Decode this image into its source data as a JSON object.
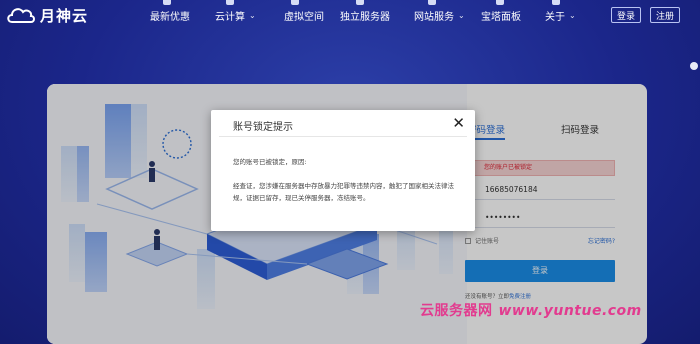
{
  "brand": {
    "name": "月神云"
  },
  "nav": {
    "items": [
      {
        "label": "最新优惠",
        "has_dropdown": false
      },
      {
        "label": "云计算",
        "has_dropdown": true
      },
      {
        "label": "虚拟空间",
        "has_dropdown": false
      },
      {
        "label": "独立服务器",
        "has_dropdown": false
      },
      {
        "label": "网站服务",
        "has_dropdown": true
      },
      {
        "label": "宝塔面板",
        "has_dropdown": false
      },
      {
        "label": "关于",
        "has_dropdown": true
      }
    ],
    "login_label": "登录",
    "register_label": "注册"
  },
  "login": {
    "tab_password": "密码登录",
    "tab_sms": "扫码登录",
    "error_text": "您的账户已被锁定",
    "phone_value": "16685076184",
    "password_mask": "••••••••",
    "remember_label": "记住账号",
    "forgot_label": "忘记密码?",
    "submit_label": "登录",
    "register_prompt": "还没有账号？立即",
    "register_link": "免费注册"
  },
  "modal": {
    "title": "账号锁定提示",
    "line1": "您的账号已被锁定，原因:",
    "body": "经查证，您涉嫌在服务器中存放暴力犯罪等违禁内容，触犯了国家相关法律法规，证据已留存，现已关停服务器，冻结账号。"
  },
  "watermark": {
    "cn": "云服务器网",
    "url": "www.yuntue.com"
  },
  "colors": {
    "accent": "#2b6fd6",
    "button": "#1a8ee8",
    "background": "#1b268a",
    "watermark": "#e23b8f"
  }
}
